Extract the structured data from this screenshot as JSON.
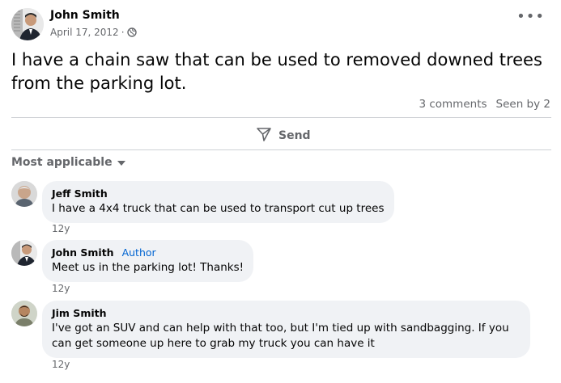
{
  "post": {
    "author": "John Smith",
    "date": "April 17, 2012",
    "separator": "·",
    "text": "I have a chain saw that can be used to removed downed trees from the parking lot.",
    "comments_count": "3 comments",
    "seen_by": "Seen by 2",
    "more_label": "•••"
  },
  "actions": {
    "send_label": "Send"
  },
  "sort": {
    "label": "Most applicable"
  },
  "comments": [
    {
      "author": "Jeff Smith",
      "badge": "",
      "text": "I have a 4x4 truck that can be used to transport cut up trees",
      "time": "12y"
    },
    {
      "author": "John Smith",
      "badge": "Author",
      "text": "Meet us in the parking lot! Thanks!",
      "time": "12y"
    },
    {
      "author": "Jim Smith",
      "badge": "",
      "text": "I've got an SUV and can help with that too, but I'm tied up with sandbagging. If you can get someone up here to grab my truck you can have it",
      "time": "12y"
    }
  ],
  "icons": {
    "post_avatar": "profile-photo",
    "privacy": "globe-icon",
    "send": "paper-plane-icon",
    "sort": "caret-down-icon",
    "more": "more-dots-icon"
  },
  "colors": {
    "secondary_text": "#65676b",
    "bubble_bg": "#f0f2f5",
    "author_badge": "#0064d1",
    "divider": "#ced0d4"
  }
}
